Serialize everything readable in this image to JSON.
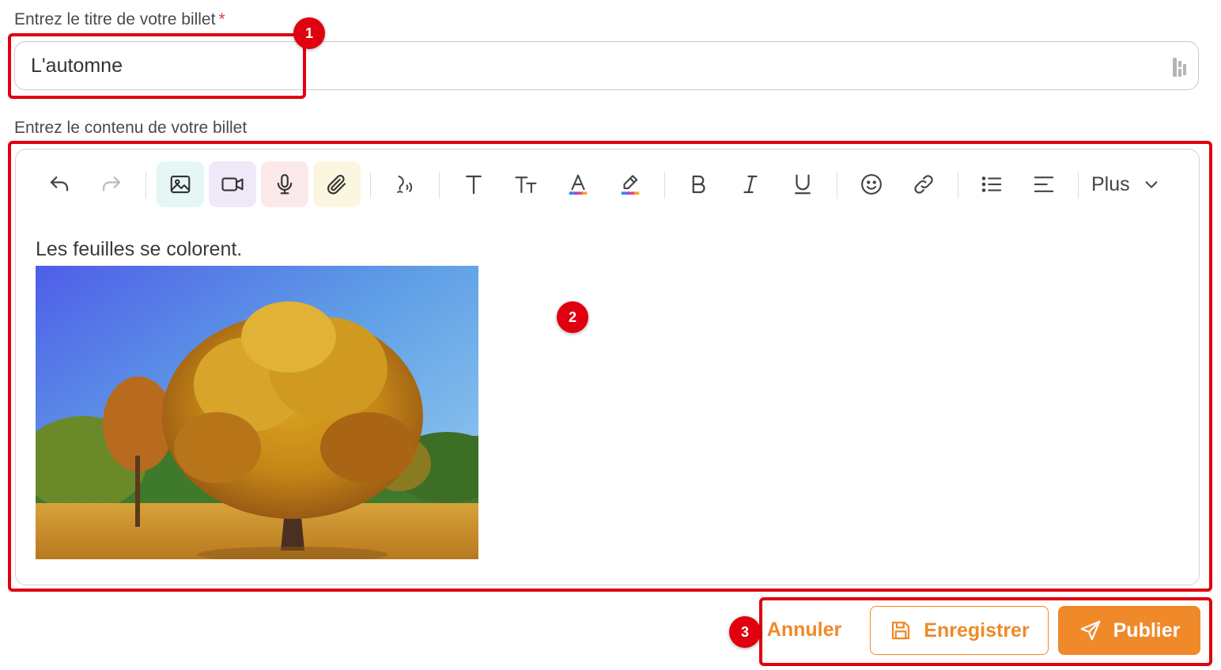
{
  "form": {
    "title_label": "Entrez le titre de votre billet",
    "required_mark": "*",
    "title_value": "L'automne",
    "content_label": "Entrez le contenu de votre billet"
  },
  "toolbar": {
    "buttons": [
      {
        "icon": "undo-icon"
      },
      {
        "icon": "redo-icon"
      },
      {
        "icon": "image-icon",
        "bg": "#e6f6f4"
      },
      {
        "icon": "video-icon",
        "bg": "#efe8f8"
      },
      {
        "icon": "microphone-icon",
        "bg": "#fbe9e9"
      },
      {
        "icon": "paperclip-icon",
        "bg": "#fbf6df"
      },
      {
        "icon": "voice-dictation-icon"
      },
      {
        "icon": "text-format-icon"
      },
      {
        "icon": "font-size-icon"
      },
      {
        "icon": "text-color-icon"
      },
      {
        "icon": "highlight-icon"
      },
      {
        "icon": "bold-icon"
      },
      {
        "icon": "italic-icon"
      },
      {
        "icon": "underline-icon"
      },
      {
        "icon": "emoji-icon"
      },
      {
        "icon": "link-icon"
      },
      {
        "icon": "bullet-list-icon"
      },
      {
        "icon": "align-icon"
      }
    ],
    "more_label": "Plus"
  },
  "editor": {
    "body_text": "Les feuilles se colorent."
  },
  "actions": {
    "cancel_label": "Annuler",
    "save_label": "Enregistrer",
    "publish_label": "Publier"
  },
  "annotations": {
    "badge_1": "1",
    "badge_2": "2",
    "badge_3": "3"
  },
  "colors": {
    "accent": "#f0892a",
    "annotation": "#e0000f"
  }
}
